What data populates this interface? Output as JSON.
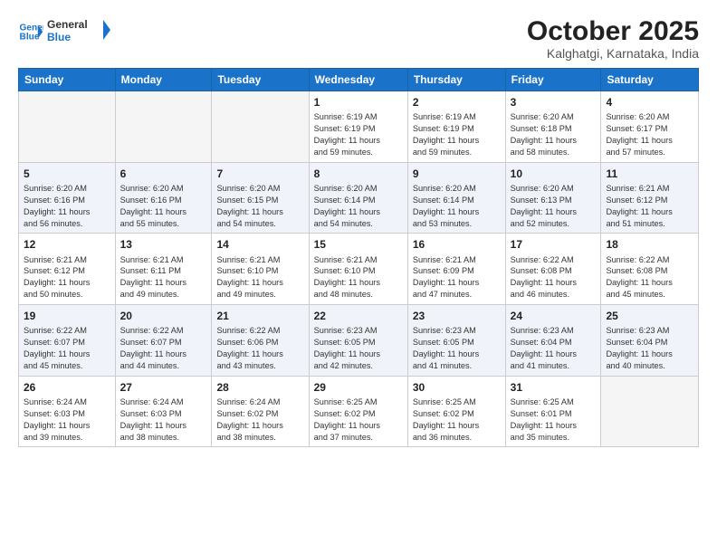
{
  "logo": {
    "line1": "General",
    "line2": "Blue"
  },
  "header": {
    "month": "October 2025",
    "location": "Kalghatgi, Karnataka, India"
  },
  "weekdays": [
    "Sunday",
    "Monday",
    "Tuesday",
    "Wednesday",
    "Thursday",
    "Friday",
    "Saturday"
  ],
  "weeks": [
    [
      {
        "day": "",
        "info": ""
      },
      {
        "day": "",
        "info": ""
      },
      {
        "day": "",
        "info": ""
      },
      {
        "day": "1",
        "info": "Sunrise: 6:19 AM\nSunset: 6:19 PM\nDaylight: 11 hours\nand 59 minutes."
      },
      {
        "day": "2",
        "info": "Sunrise: 6:19 AM\nSunset: 6:19 PM\nDaylight: 11 hours\nand 59 minutes."
      },
      {
        "day": "3",
        "info": "Sunrise: 6:20 AM\nSunset: 6:18 PM\nDaylight: 11 hours\nand 58 minutes."
      },
      {
        "day": "4",
        "info": "Sunrise: 6:20 AM\nSunset: 6:17 PM\nDaylight: 11 hours\nand 57 minutes."
      }
    ],
    [
      {
        "day": "5",
        "info": "Sunrise: 6:20 AM\nSunset: 6:16 PM\nDaylight: 11 hours\nand 56 minutes."
      },
      {
        "day": "6",
        "info": "Sunrise: 6:20 AM\nSunset: 6:16 PM\nDaylight: 11 hours\nand 55 minutes."
      },
      {
        "day": "7",
        "info": "Sunrise: 6:20 AM\nSunset: 6:15 PM\nDaylight: 11 hours\nand 54 minutes."
      },
      {
        "day": "8",
        "info": "Sunrise: 6:20 AM\nSunset: 6:14 PM\nDaylight: 11 hours\nand 54 minutes."
      },
      {
        "day": "9",
        "info": "Sunrise: 6:20 AM\nSunset: 6:14 PM\nDaylight: 11 hours\nand 53 minutes."
      },
      {
        "day": "10",
        "info": "Sunrise: 6:20 AM\nSunset: 6:13 PM\nDaylight: 11 hours\nand 52 minutes."
      },
      {
        "day": "11",
        "info": "Sunrise: 6:21 AM\nSunset: 6:12 PM\nDaylight: 11 hours\nand 51 minutes."
      }
    ],
    [
      {
        "day": "12",
        "info": "Sunrise: 6:21 AM\nSunset: 6:12 PM\nDaylight: 11 hours\nand 50 minutes."
      },
      {
        "day": "13",
        "info": "Sunrise: 6:21 AM\nSunset: 6:11 PM\nDaylight: 11 hours\nand 49 minutes."
      },
      {
        "day": "14",
        "info": "Sunrise: 6:21 AM\nSunset: 6:10 PM\nDaylight: 11 hours\nand 49 minutes."
      },
      {
        "day": "15",
        "info": "Sunrise: 6:21 AM\nSunset: 6:10 PM\nDaylight: 11 hours\nand 48 minutes."
      },
      {
        "day": "16",
        "info": "Sunrise: 6:21 AM\nSunset: 6:09 PM\nDaylight: 11 hours\nand 47 minutes."
      },
      {
        "day": "17",
        "info": "Sunrise: 6:22 AM\nSunset: 6:08 PM\nDaylight: 11 hours\nand 46 minutes."
      },
      {
        "day": "18",
        "info": "Sunrise: 6:22 AM\nSunset: 6:08 PM\nDaylight: 11 hours\nand 45 minutes."
      }
    ],
    [
      {
        "day": "19",
        "info": "Sunrise: 6:22 AM\nSunset: 6:07 PM\nDaylight: 11 hours\nand 45 minutes."
      },
      {
        "day": "20",
        "info": "Sunrise: 6:22 AM\nSunset: 6:07 PM\nDaylight: 11 hours\nand 44 minutes."
      },
      {
        "day": "21",
        "info": "Sunrise: 6:22 AM\nSunset: 6:06 PM\nDaylight: 11 hours\nand 43 minutes."
      },
      {
        "day": "22",
        "info": "Sunrise: 6:23 AM\nSunset: 6:05 PM\nDaylight: 11 hours\nand 42 minutes."
      },
      {
        "day": "23",
        "info": "Sunrise: 6:23 AM\nSunset: 6:05 PM\nDaylight: 11 hours\nand 41 minutes."
      },
      {
        "day": "24",
        "info": "Sunrise: 6:23 AM\nSunset: 6:04 PM\nDaylight: 11 hours\nand 41 minutes."
      },
      {
        "day": "25",
        "info": "Sunrise: 6:23 AM\nSunset: 6:04 PM\nDaylight: 11 hours\nand 40 minutes."
      }
    ],
    [
      {
        "day": "26",
        "info": "Sunrise: 6:24 AM\nSunset: 6:03 PM\nDaylight: 11 hours\nand 39 minutes."
      },
      {
        "day": "27",
        "info": "Sunrise: 6:24 AM\nSunset: 6:03 PM\nDaylight: 11 hours\nand 38 minutes."
      },
      {
        "day": "28",
        "info": "Sunrise: 6:24 AM\nSunset: 6:02 PM\nDaylight: 11 hours\nand 38 minutes."
      },
      {
        "day": "29",
        "info": "Sunrise: 6:25 AM\nSunset: 6:02 PM\nDaylight: 11 hours\nand 37 minutes."
      },
      {
        "day": "30",
        "info": "Sunrise: 6:25 AM\nSunset: 6:02 PM\nDaylight: 11 hours\nand 36 minutes."
      },
      {
        "day": "31",
        "info": "Sunrise: 6:25 AM\nSunset: 6:01 PM\nDaylight: 11 hours\nand 35 minutes."
      },
      {
        "day": "",
        "info": ""
      }
    ]
  ]
}
